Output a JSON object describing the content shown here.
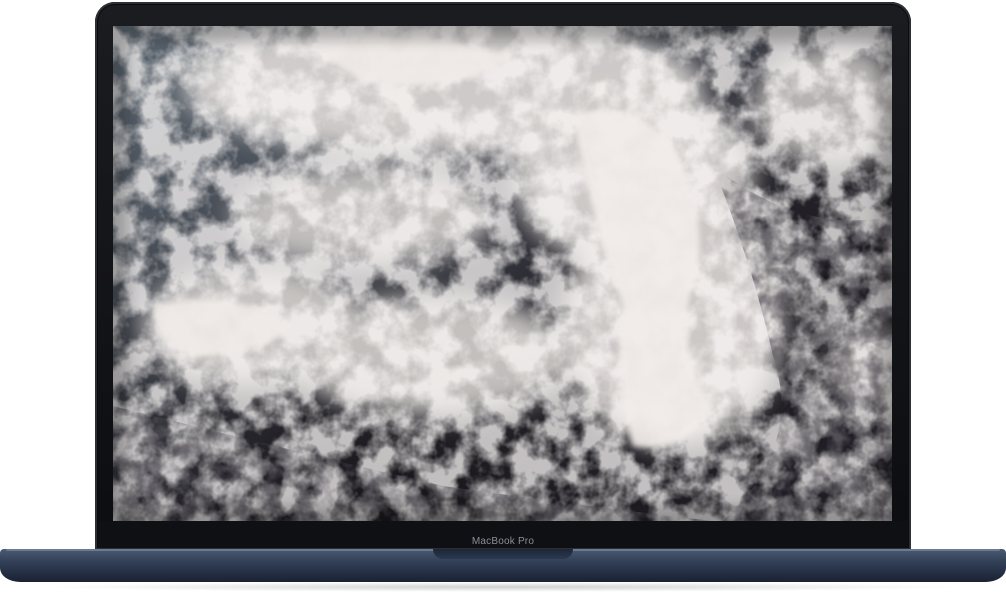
{
  "device": {
    "model_label": "MacBook Pro",
    "bezel_color": "#0d0e11",
    "body_color": "#2f3b52"
  },
  "screen": {
    "wallpaper": "ocean-waves-photo"
  }
}
